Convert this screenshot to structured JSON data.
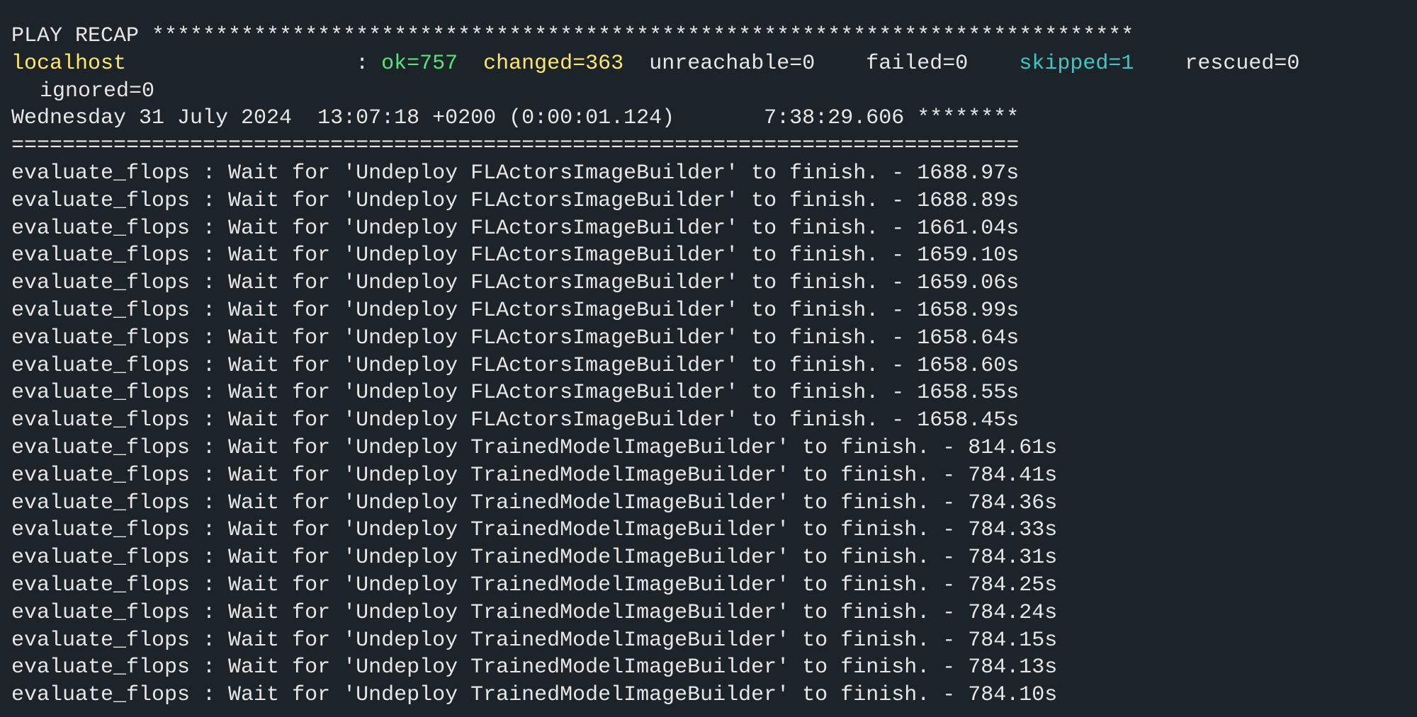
{
  "recap": {
    "header": "PLAY RECAP *****************************************************************************",
    "host": "localhost",
    "host_pad": "                  : ",
    "ok": "ok=757",
    "changed": "changed=363",
    "unreachable": "unreachable=0",
    "failed": "failed=0",
    "skipped": "skipped=1",
    "rescued": "rescued=0",
    "ignored": "ignored=0",
    "colors": {
      "host": "#ffe66d",
      "ok": "#53e67a",
      "changed": "#ffe66d",
      "skipped": "#3ec7c7"
    }
  },
  "timing": {
    "line": "Wednesday 31 July 2024  13:07:18 +0200 (0:00:01.124)       7:38:29.606 ********",
    "separator": "==============================================================================="
  },
  "tasks": [
    "evaluate_flops : Wait for 'Undeploy FLActorsImageBuilder' to finish. - 1688.97s",
    "evaluate_flops : Wait for 'Undeploy FLActorsImageBuilder' to finish. - 1688.89s",
    "evaluate_flops : Wait for 'Undeploy FLActorsImageBuilder' to finish. - 1661.04s",
    "evaluate_flops : Wait for 'Undeploy FLActorsImageBuilder' to finish. - 1659.10s",
    "evaluate_flops : Wait for 'Undeploy FLActorsImageBuilder' to finish. - 1659.06s",
    "evaluate_flops : Wait for 'Undeploy FLActorsImageBuilder' to finish. - 1658.99s",
    "evaluate_flops : Wait for 'Undeploy FLActorsImageBuilder' to finish. - 1658.64s",
    "evaluate_flops : Wait for 'Undeploy FLActorsImageBuilder' to finish. - 1658.60s",
    "evaluate_flops : Wait for 'Undeploy FLActorsImageBuilder' to finish. - 1658.55s",
    "evaluate_flops : Wait for 'Undeploy FLActorsImageBuilder' to finish. - 1658.45s",
    "evaluate_flops : Wait for 'Undeploy TrainedModelImageBuilder' to finish. - 814.61s",
    "evaluate_flops : Wait for 'Undeploy TrainedModelImageBuilder' to finish. - 784.41s",
    "evaluate_flops : Wait for 'Undeploy TrainedModelImageBuilder' to finish. - 784.36s",
    "evaluate_flops : Wait for 'Undeploy TrainedModelImageBuilder' to finish. - 784.33s",
    "evaluate_flops : Wait for 'Undeploy TrainedModelImageBuilder' to finish. - 784.31s",
    "evaluate_flops : Wait for 'Undeploy TrainedModelImageBuilder' to finish. - 784.25s",
    "evaluate_flops : Wait for 'Undeploy TrainedModelImageBuilder' to finish. - 784.24s",
    "evaluate_flops : Wait for 'Undeploy TrainedModelImageBuilder' to finish. - 784.15s",
    "evaluate_flops : Wait for 'Undeploy TrainedModelImageBuilder' to finish. - 784.13s",
    "evaluate_flops : Wait for 'Undeploy TrainedModelImageBuilder' to finish. - 784.10s"
  ]
}
